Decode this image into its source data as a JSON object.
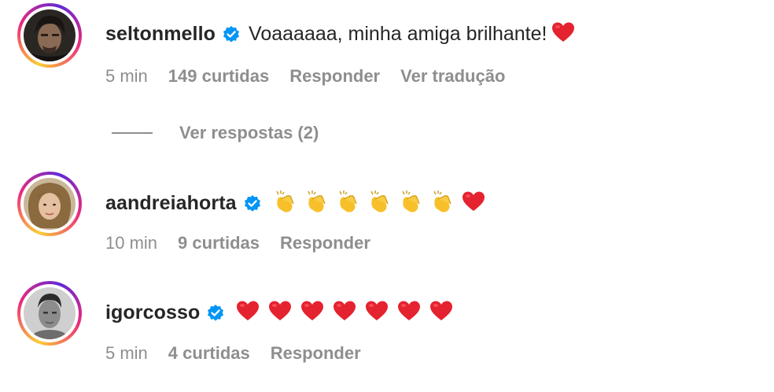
{
  "colors": {
    "text": "#262626",
    "meta": "#8e8e8e",
    "verified_blue": "#0095f6",
    "heart_red": "#e5222f",
    "clap_yellow": "#f7c02b"
  },
  "comments": [
    {
      "username": "seltonmello",
      "verified": true,
      "text": "Voaaaaaa, minha amiga brilhante!",
      "emojis": [
        "heart-emoji"
      ],
      "time": "5 min",
      "likes": "149 curtidas",
      "reply_label": "Responder",
      "translate_label": "Ver tradução",
      "view_replies_label": "Ver respostas (2)"
    },
    {
      "username": "aandreiahorta",
      "verified": true,
      "text": "",
      "emojis": [
        "clapping-hands-emoji",
        "clapping-hands-emoji",
        "clapping-hands-emoji",
        "clapping-hands-emoji",
        "clapping-hands-emoji",
        "clapping-hands-emoji",
        "heart-emoji"
      ],
      "time": "10 min",
      "likes": "9 curtidas",
      "reply_label": "Responder"
    },
    {
      "username": "igorcosso",
      "verified": true,
      "text": "",
      "emojis": [
        "heart-emoji",
        "heart-emoji",
        "heart-emoji",
        "heart-emoji",
        "heart-emoji",
        "heart-emoji",
        "heart-emoji"
      ],
      "time": "5 min",
      "likes": "4 curtidas",
      "reply_label": "Responder"
    }
  ]
}
